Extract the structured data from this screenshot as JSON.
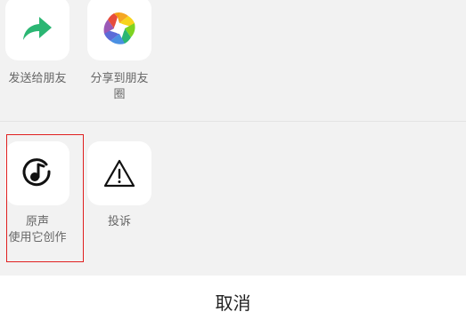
{
  "share_row": {
    "send_to_friend": {
      "label": "发送给朋友",
      "icon": "share-arrow-icon",
      "icon_color": "#2bb673"
    },
    "share_moments": {
      "label_line1": "分享到朋友",
      "label_line2": "圈",
      "icon": "aperture-icon"
    }
  },
  "tools_row": {
    "original_sound": {
      "label_line1": "原声",
      "label_line2": "使用它创作",
      "icon": "music-note-icon"
    },
    "report": {
      "label": "投诉",
      "icon": "warning-triangle-icon"
    }
  },
  "cancel": {
    "label": "取消"
  },
  "colors": {
    "highlight": "#e02020",
    "sheet_bg": "#f2f2f2",
    "tile_bg": "#ffffff",
    "label_text": "#666666"
  }
}
